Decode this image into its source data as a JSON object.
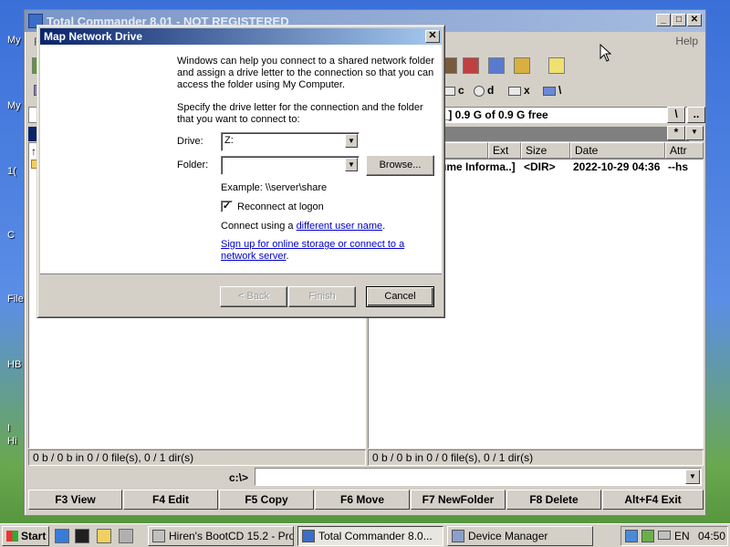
{
  "desktop": {
    "labels": [
      "My",
      "My",
      "1(",
      "C",
      "File",
      "HB",
      "I",
      "Hi"
    ]
  },
  "tc": {
    "title": "Total Commander 8.01 - NOT REGISTERED",
    "menu_first": "F",
    "menu_help": "Help",
    "drives": [
      {
        "letter": "c"
      },
      {
        "letter": "d"
      },
      {
        "letter": "x"
      },
      {
        "letter": "\\"
      }
    ],
    "free_space": "e_]  0.9 G of 0.9 G free",
    "root_btn": "\\",
    "up_btn": "..",
    "star_btn": "*",
    "columns": {
      "ext": "Ext",
      "size": "Size",
      "date": "Date",
      "attr": "Attr"
    },
    "right_row": {
      "name": "ume Informa..]",
      "size": "<DIR>",
      "date": "2022-10-29 04:36",
      "attr": "--hs"
    },
    "left_arrow": "↑",
    "status_left": "0 b / 0 b in 0 / 0 file(s), 0 / 1 dir(s)",
    "status_right": "0 b / 0 b in 0 / 0 file(s), 0 / 1 dir(s)",
    "cmd_path": "c:\\>",
    "fkeys": [
      "F3 View",
      "F4 Edit",
      "F5 Copy",
      "F6 Move",
      "F7 NewFolder",
      "F8 Delete",
      "Alt+F4 Exit"
    ]
  },
  "dialog": {
    "title": "Map Network Drive",
    "intro_1": "Windows can help you connect to a shared network folder",
    "intro_2": "and assign a drive letter to the connection so that you can",
    "intro_3": "access the folder using My Computer.",
    "specify_1": "Specify the drive letter for the connection and the folder",
    "specify_2": "that you want to connect to:",
    "drive_label": "Drive:",
    "drive_value": "Z:",
    "folder_label": "Folder:",
    "folder_value": "",
    "browse": "Browse...",
    "example": "Example: \\\\server\\share",
    "reconnect": "Reconnect at logon",
    "reconnect_checked": true,
    "connect_prefix": "Connect using a ",
    "connect_link": "different user name",
    "connect_suffix": ".",
    "signup_1": "Sign up for online storage or connect to a",
    "signup_2": "network server",
    "signup_suffix": ".",
    "back": "< Back",
    "finish": "Finish",
    "cancel": "Cancel"
  },
  "taskbar": {
    "start": "Start",
    "tasks": [
      {
        "label": "Hiren's BootCD 15.2 - Pro..."
      },
      {
        "label": "Total Commander 8.0..."
      },
      {
        "label": "Device Manager"
      }
    ],
    "lang": "EN",
    "time": "04:50"
  }
}
